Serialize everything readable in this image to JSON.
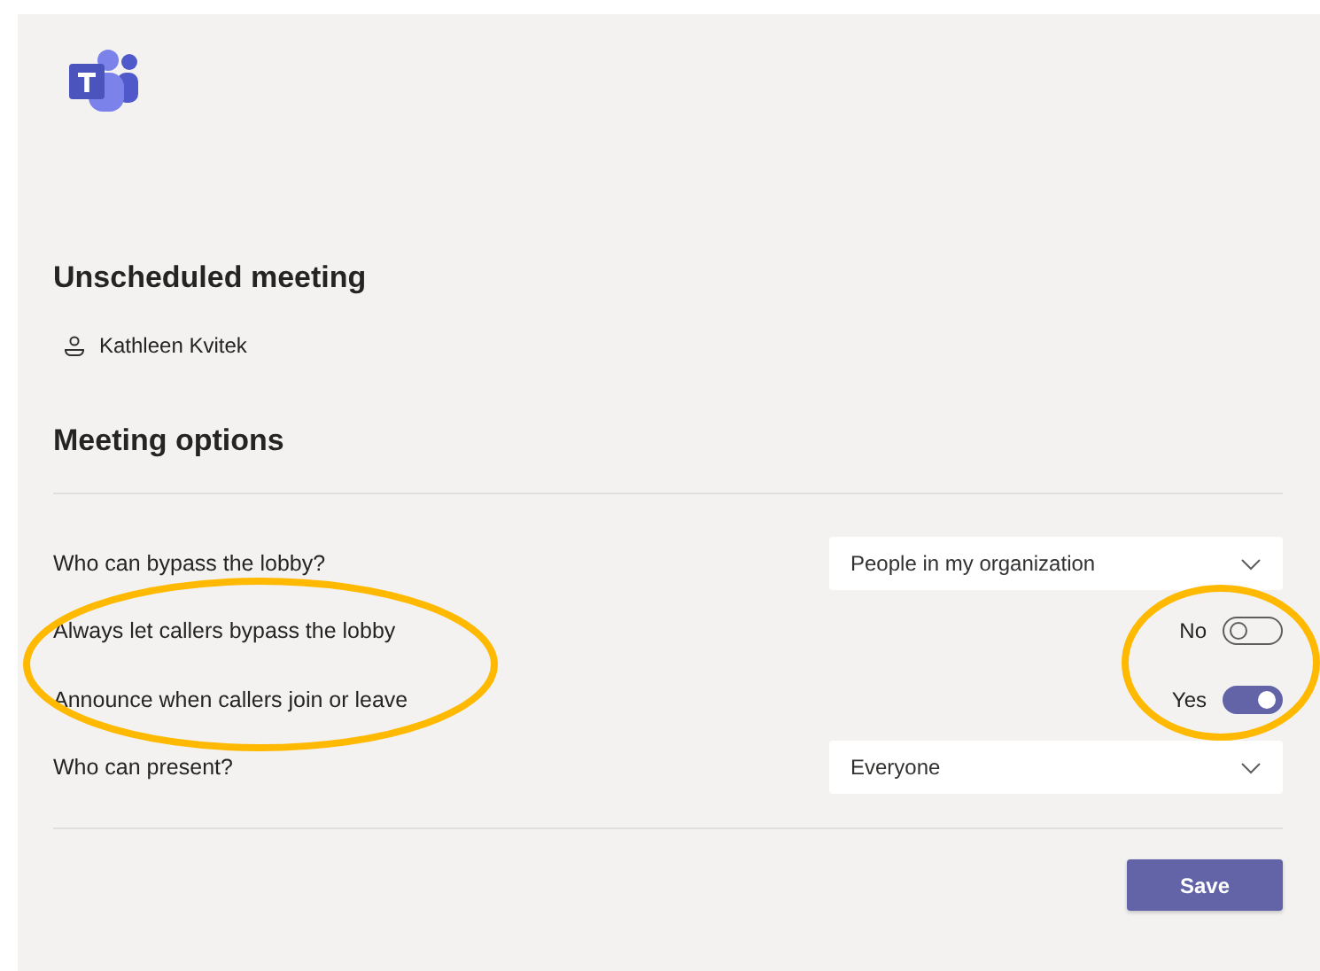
{
  "meeting": {
    "title": "Unscheduled meeting",
    "organizer": "Kathleen Kvitek"
  },
  "options": {
    "heading": "Meeting options",
    "rows": [
      {
        "kind": "dropdown",
        "label": "Who can bypass the lobby?",
        "value": "People in my organization"
      },
      {
        "kind": "toggle",
        "label": "Always let callers bypass the lobby",
        "state_label": "No",
        "on": false
      },
      {
        "kind": "toggle",
        "label": "Announce when callers join or leave",
        "state_label": "Yes",
        "on": true
      },
      {
        "kind": "dropdown",
        "label": "Who can present?",
        "value": "Everyone"
      }
    ]
  },
  "buttons": [
    {
      "label": "Save"
    }
  ]
}
